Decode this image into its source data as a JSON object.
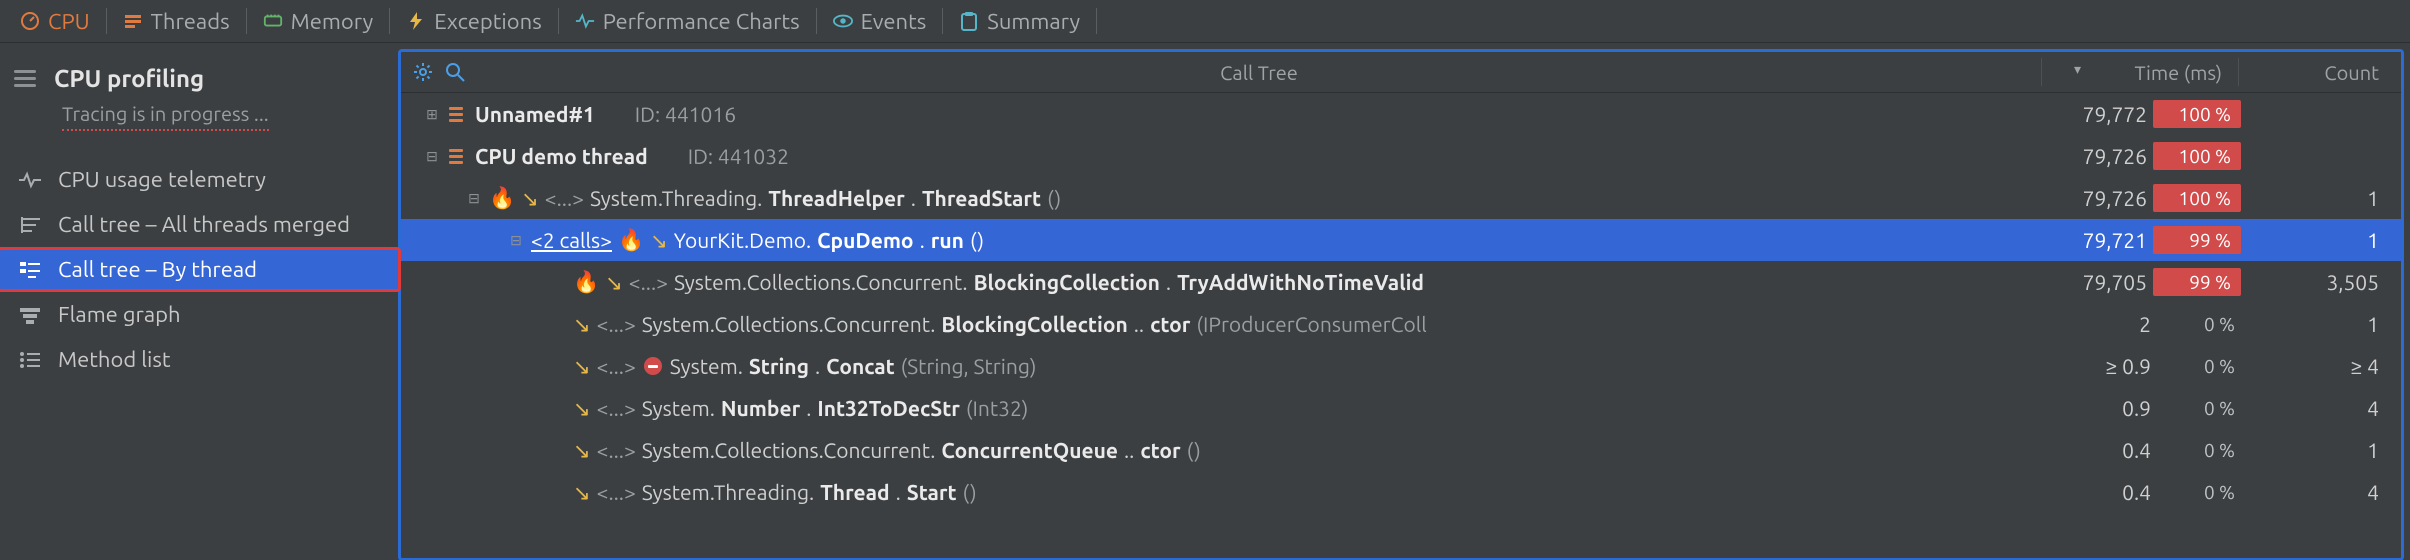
{
  "topbar": {
    "tabs": [
      {
        "id": "cpu",
        "label": "CPU"
      },
      {
        "id": "threads",
        "label": "Threads"
      },
      {
        "id": "memory",
        "label": "Memory"
      },
      {
        "id": "exceptions",
        "label": "Exceptions"
      },
      {
        "id": "perf",
        "label": "Performance Charts"
      },
      {
        "id": "events",
        "label": "Events"
      },
      {
        "id": "summary",
        "label": "Summary"
      }
    ],
    "active": "cpu"
  },
  "sidebar": {
    "title": "CPU profiling",
    "subtitle": "Tracing is in progress ...",
    "items": [
      {
        "id": "telemetry",
        "label": "CPU usage telemetry"
      },
      {
        "id": "merged",
        "label": "Call tree – All threads merged"
      },
      {
        "id": "bythread",
        "label": "Call tree – By thread"
      },
      {
        "id": "flame",
        "label": "Flame graph"
      },
      {
        "id": "methods",
        "label": "Method list"
      }
    ],
    "selected": "bythread"
  },
  "content": {
    "title": "Call Tree",
    "columns": {
      "time": "Time (ms)",
      "count": "Count"
    },
    "rows": [
      {
        "depth": 0,
        "expander": "plus",
        "thread": true,
        "label_bold": "Unnamed#1",
        "id_label": "ID: 441016",
        "time": "79,772",
        "pct": "100 %",
        "pct_red": true,
        "count": ""
      },
      {
        "depth": 0,
        "expander": "minus",
        "thread": true,
        "label_bold": "CPU demo thread",
        "id_label": "ID: 441032",
        "time": "79,726",
        "pct": "100 %",
        "pct_red": true,
        "count": ""
      },
      {
        "depth": 1,
        "expander": "minus",
        "flame": true,
        "arrow": true,
        "ellipsis": true,
        "ns": "System.Threading.",
        "bold": "ThreadHelper",
        "dot": ".",
        "bold2": "ThreadStart",
        "sig": "()",
        "time": "79,726",
        "pct": "100 %",
        "pct_red": true,
        "count": "1"
      },
      {
        "depth": 2,
        "expander": "minus",
        "selected": true,
        "prefix_link": "<2 calls>",
        "flame": true,
        "arrow": true,
        "ns": "YourKit.Demo.",
        "bold": "CpuDemo",
        "dot": ".",
        "bold2": "run",
        "sig": "()",
        "time": "79,721",
        "pct": "99 %",
        "pct_red": true,
        "count": "1"
      },
      {
        "depth": 3,
        "flame": true,
        "arrow": true,
        "ellipsis": true,
        "ns": "System.Collections.Concurrent.",
        "bold": "BlockingCollection",
        "dot": ".",
        "bold2": "TryAddWithNoTimeValid",
        "time": "79,705",
        "pct": "99 %",
        "pct_red": true,
        "count": "3,505"
      },
      {
        "depth": 3,
        "arrow": true,
        "ellipsis": true,
        "ns": "System.Collections.Concurrent.",
        "bold": "BlockingCollection",
        "dot": "..",
        "bold2": "ctor",
        "sig": "(IProducerConsumerColl",
        "time": "2",
        "pct": "0 %",
        "count": "1"
      },
      {
        "depth": 3,
        "arrow": true,
        "ellipsis": true,
        "stop": true,
        "ns": "System.",
        "bold": "String",
        "dot": ".",
        "bold2": "Concat",
        "sig": "(String, String)",
        "time": "≥ 0.9",
        "pct": "0 %",
        "count": "≥ 4"
      },
      {
        "depth": 3,
        "arrow": true,
        "ellipsis": true,
        "ns": "System.",
        "bold": "Number",
        "dot": ".",
        "bold2": "Int32ToDecStr",
        "sig": "(Int32)",
        "time": "0.9",
        "pct": "0 %",
        "count": "4"
      },
      {
        "depth": 3,
        "arrow": true,
        "ellipsis": true,
        "ns": "System.Collections.Concurrent.",
        "bold": "ConcurrentQueue",
        "dot": "..",
        "bold2": "ctor",
        "sig": "()",
        "time": "0.4",
        "pct": "0 %",
        "count": "1"
      },
      {
        "depth": 3,
        "arrow": true,
        "ellipsis": true,
        "ns": "System.Threading.",
        "bold": "Thread",
        "dot": ".",
        "bold2": "Start",
        "sig": "()",
        "time": "0.4",
        "pct": "0 %",
        "count": "4"
      }
    ]
  }
}
